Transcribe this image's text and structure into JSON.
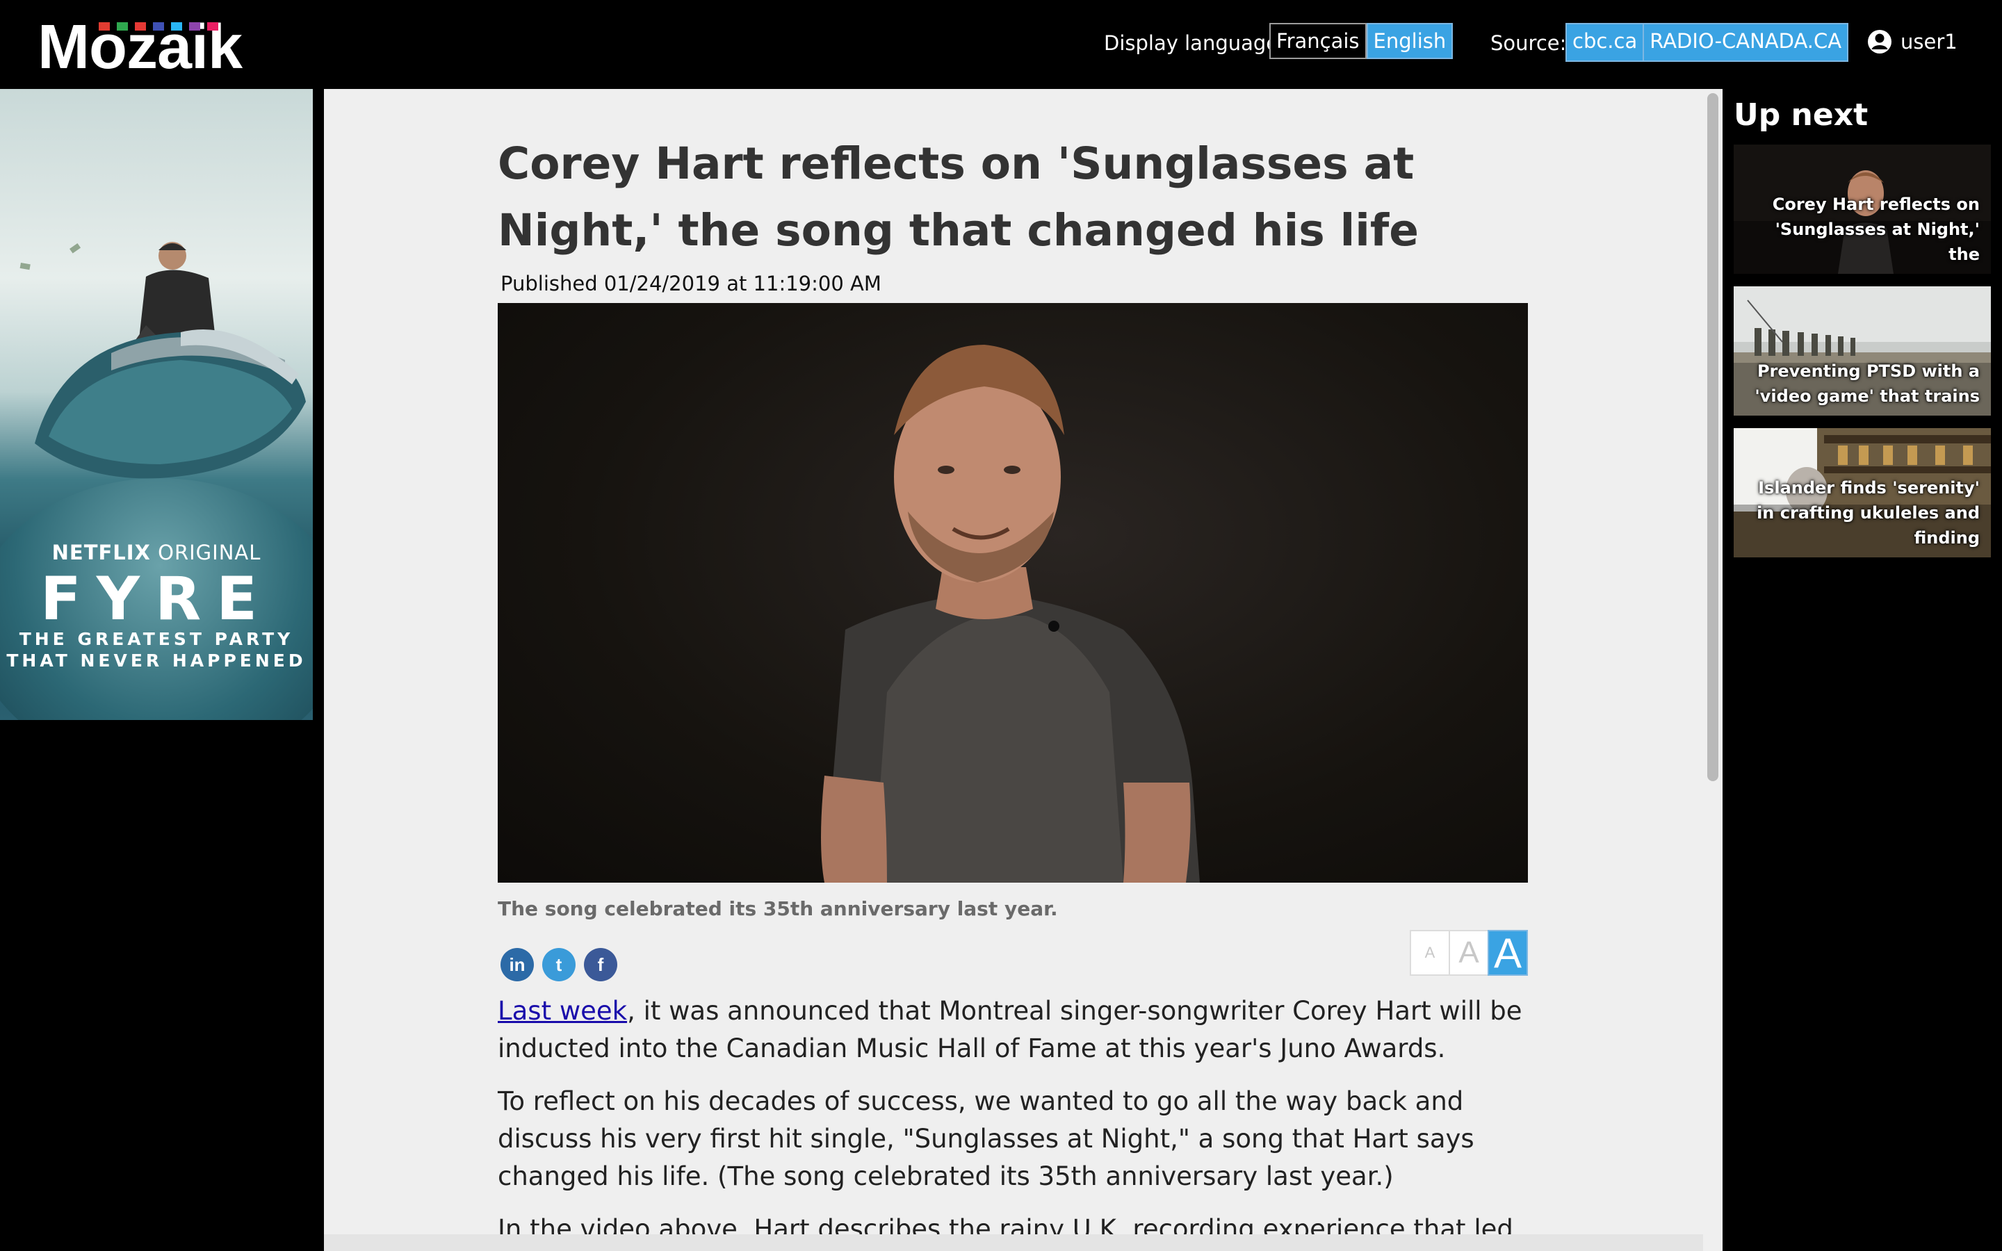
{
  "header": {
    "logo": "Mozaik",
    "display_language_label": "Display language",
    "lang_fr": "Français",
    "lang_en": "English",
    "source_label": "Source:",
    "source_cbc": "cbc.ca",
    "source_rc": "RADIO-CANADA.CA",
    "user_name": "user1",
    "logo_colors": [
      "#e03c31",
      "#2fa84f",
      "#e53935",
      "#3f51b5",
      "#29b6f6",
      "#8e44ad",
      "#e91e63"
    ]
  },
  "ad": {
    "netflix": "NETFLIX",
    "original": "ORIGINAL",
    "title": "FYRE",
    "tagline_1": "THE GREATEST PARTY",
    "tagline_2": "THAT NEVER HAPPENED"
  },
  "article": {
    "title": "Corey Hart reflects on 'Sunglasses at Night,' the song that changed his life",
    "published": "Published 01/24/2019 at 11:19:00 AM",
    "caption": "The song celebrated its 35th anniversary last year.",
    "share": {
      "linkedin": "in",
      "twitter": "t",
      "facebook": "f"
    },
    "font_size": {
      "small": "A",
      "medium": "A",
      "large": "A"
    },
    "p1_link": "Last week",
    "p1_rest": ", it was announced that Montreal singer-songwriter Corey Hart will be inducted into the Canadian Music Hall of Fame at this year's Juno Awards.",
    "p2": "To reflect on his decades of success, we wanted to go all the way back and discuss his very first hit single, \"Sunglasses at Night,\" a song that Hart says changed his life. (The song celebrated its 35th anniversary last year.)",
    "p3": "In the video above, Hart describes the rainy U.K. recording experience that led him to"
  },
  "upnext": {
    "heading": "Up next",
    "items": [
      {
        "caption": "Corey Hart reflects on 'Sunglasses at Night,' the"
      },
      {
        "caption": "Preventing PTSD with a 'video game' that trains"
      },
      {
        "caption": "Islander finds 'serenity' in crafting ukuleles and finding"
      }
    ]
  }
}
